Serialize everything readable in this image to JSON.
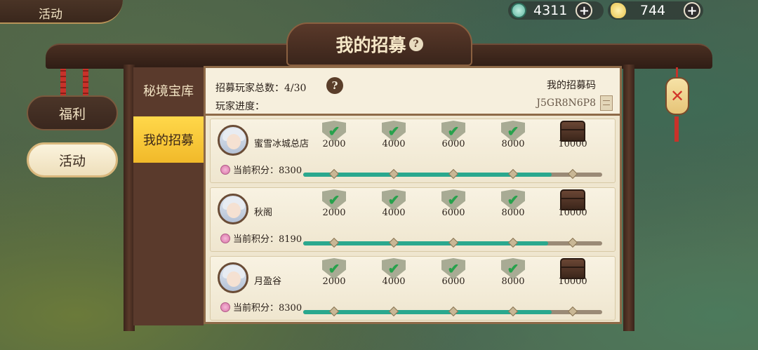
{
  "top_tab": {
    "label": "活动"
  },
  "currency": [
    {
      "icon": "jade-coin-icon",
      "value": "4311",
      "color": "#5fb5a0"
    },
    {
      "icon": "gold-ingot-icon",
      "value": "744",
      "color": "#e8c24a"
    }
  ],
  "left_nav": {
    "welfare": "福利",
    "activity": "活动"
  },
  "panel": {
    "title": "我的招募",
    "help_glyph": "?"
  },
  "side_tabs": {
    "treasury": "秘境宝库",
    "recruit": "我的招募"
  },
  "summary": {
    "total_label": "招募玩家总数：4/30",
    "progress_label": "玩家进度：",
    "help_glyph": "?",
    "code_label": "我的招募码",
    "code_value": "J5GR8N6P8"
  },
  "recruits": [
    {
      "name": "蜜雪冰城总店",
      "score_label": "当前积分：8300",
      "score": 8300,
      "milestones": [
        "2000",
        "4000",
        "6000",
        "8000",
        "10000"
      ],
      "claimed": [
        true,
        true,
        true,
        true,
        false
      ]
    },
    {
      "name": "秋阁",
      "score_label": "当前积分：8190",
      "score": 8190,
      "milestones": [
        "2000",
        "4000",
        "6000",
        "8000",
        "10000"
      ],
      "claimed": [
        true,
        true,
        true,
        true,
        false
      ]
    },
    {
      "name": "月盈谷",
      "score_label": "当前积分：8300",
      "score": 8300,
      "milestones": [
        "2000",
        "4000",
        "6000",
        "8000",
        "10000"
      ],
      "claimed": [
        true,
        true,
        true,
        true,
        false
      ]
    }
  ],
  "progress_max": 10000,
  "close_glyph": "✕",
  "colors": {
    "accent_gold": "#f1b92a",
    "progress_teal": "#2aa88e",
    "frame_brown": "#5a3a2c"
  }
}
